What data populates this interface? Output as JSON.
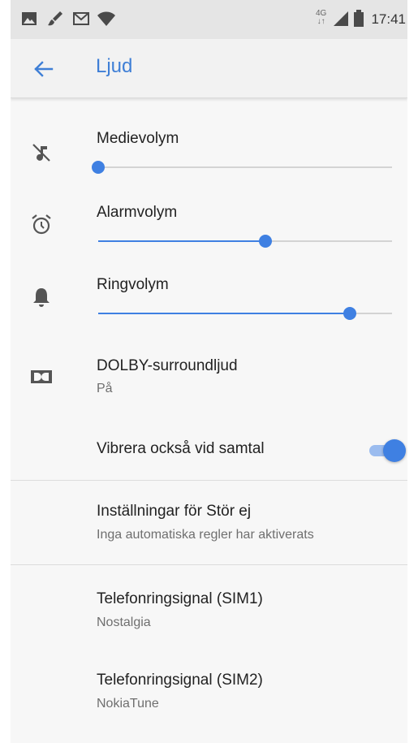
{
  "status_bar": {
    "time": "17:41",
    "network": "4G",
    "icons": [
      "image-icon",
      "brush-icon",
      "mail-icon",
      "wifi-icon",
      "signal-icon",
      "battery-icon"
    ]
  },
  "app_bar": {
    "title": "Ljud",
    "back_icon": "arrow-back-icon"
  },
  "volumes": [
    {
      "label": "Medievolym",
      "icon": "music-off-icon",
      "level": 0.0
    },
    {
      "label": "Alarmvolym",
      "icon": "alarm-icon",
      "level": 0.57
    },
    {
      "label": "Ringvolym",
      "icon": "bell-icon",
      "level": 0.856
    }
  ],
  "dolby": {
    "label": "DOLBY-surroundljud",
    "value": "På",
    "icon": "dolby-icon"
  },
  "vibrate": {
    "label": "Vibrera också vid samtal",
    "enabled": true
  },
  "dnd": {
    "label": "Inställningar för Stör ej",
    "summary": "Inga automatiska regler har aktiverats"
  },
  "ringtones": [
    {
      "label": "Telefonringsignal (SIM1)",
      "value": "Nostalgia"
    },
    {
      "label": "Telefonringsignal (SIM2)",
      "value": "NokiaTune"
    }
  ],
  "colors": {
    "accent": "#3f80e2",
    "title": "#3f7fd6"
  }
}
